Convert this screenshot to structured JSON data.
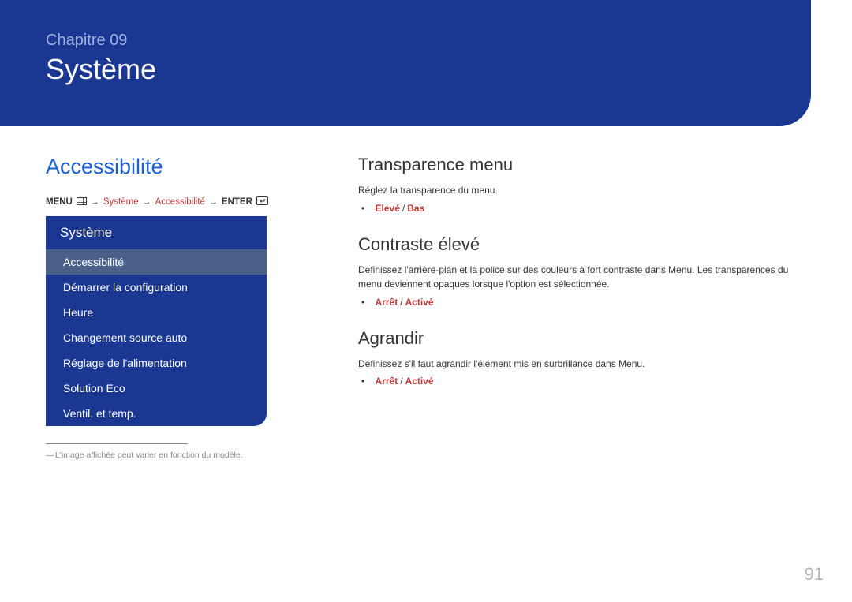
{
  "banner": {
    "chapter": "Chapitre 09",
    "title": "Système"
  },
  "left": {
    "section_title": "Accessibilité",
    "breadcrumb": {
      "menu_label": "MENU",
      "path1": "Système",
      "path2": "Accessibilité",
      "enter_label": "ENTER"
    },
    "menu": {
      "header": "Système",
      "items": [
        "Accessibilité",
        "Démarrer la configuration",
        "Heure",
        "Changement source auto",
        "Réglage de l'alimentation",
        "Solution Eco",
        "Ventil. et temp."
      ]
    },
    "footnote": "L'image affichée peut varier en fonction du modèle."
  },
  "right": {
    "b1": {
      "title": "Transparence menu",
      "desc": "Réglez la transparence du menu.",
      "opt_a": "Elevé",
      "opt_b": "Bas"
    },
    "b2": {
      "title": "Contraste élevé",
      "desc": "Définissez l'arrière-plan et la police sur des couleurs à fort contraste dans Menu. Les transparences du menu deviennent opaques lorsque l'option est sélectionnée.",
      "opt_a": "Arrêt",
      "opt_b": "Activé"
    },
    "b3": {
      "title": "Agrandir",
      "desc": "Définissez s'il faut agrandir l'élément mis en surbrillance dans Menu.",
      "opt_a": "Arrêt",
      "opt_b": "Activé"
    }
  },
  "page_number": "91"
}
